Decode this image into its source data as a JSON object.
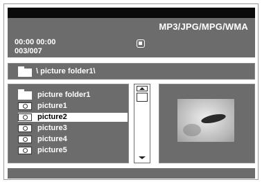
{
  "header": {
    "mode_title": "MP3/JPG/MPG/WMA"
  },
  "playback": {
    "time": "00:00  00:00",
    "counter": "003/007",
    "status_icon": "stop-icon"
  },
  "path": {
    "text": "\\ picture folder1\\"
  },
  "file_list": {
    "items": [
      {
        "label": "picture folder1",
        "icon": "folder-icon",
        "selected": false
      },
      {
        "label": "picture1",
        "icon": "camera-icon",
        "selected": false
      },
      {
        "label": "picture2",
        "icon": "camera-icon",
        "selected": true
      },
      {
        "label": "picture3",
        "icon": "camera-icon",
        "selected": false
      },
      {
        "label": "picture4",
        "icon": "camera-icon",
        "selected": false
      },
      {
        "label": "picture5",
        "icon": "camera-icon",
        "selected": false
      }
    ]
  },
  "colors": {
    "panel": "#6c6c6c",
    "topbar": "#0a0a0a",
    "text": "#ffffff",
    "selection": "#ffffff"
  }
}
